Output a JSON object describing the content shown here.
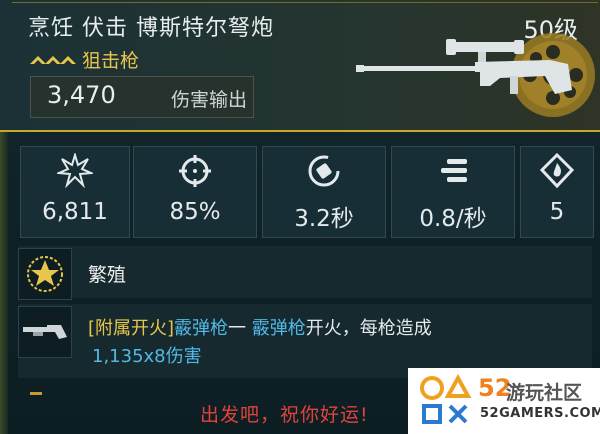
{
  "weapon": {
    "name": "烹饪 伏击 博斯特尔弩炮",
    "level": "50级",
    "type": "狙击枪",
    "damage_value": "3,470",
    "damage_label": "伤害输出"
  },
  "stats": [
    {
      "icon": "damage-burst-icon",
      "value": "6,811"
    },
    {
      "icon": "crosshair-icon",
      "value": "85%"
    },
    {
      "icon": "reload-icon",
      "value": "3.2秒"
    },
    {
      "icon": "bullets-icon",
      "value": "0.8/秒"
    },
    {
      "icon": "flame-element-icon",
      "value": "5"
    }
  ],
  "perk": {
    "icon": "star-badge-icon",
    "name": "繁殖"
  },
  "alt_fire": {
    "icon": "shotgun-icon",
    "prefix": "[附属开火]",
    "weapon1": "霰弹枪",
    "dash": "一 ",
    "weapon2": "霰弹枪",
    "rest": "开火，每枪造成",
    "damage": "1,135x8伤害"
  },
  "flavor_text": "出发吧，祝你好运!",
  "watermark": {
    "number": "52",
    "name": "游玩社区",
    "url": "52GAMERS.COM"
  },
  "colors": {
    "accent_gold": "#e7c64b",
    "highlight_blue": "#52b8e6",
    "flavor_red": "#e0433c"
  }
}
